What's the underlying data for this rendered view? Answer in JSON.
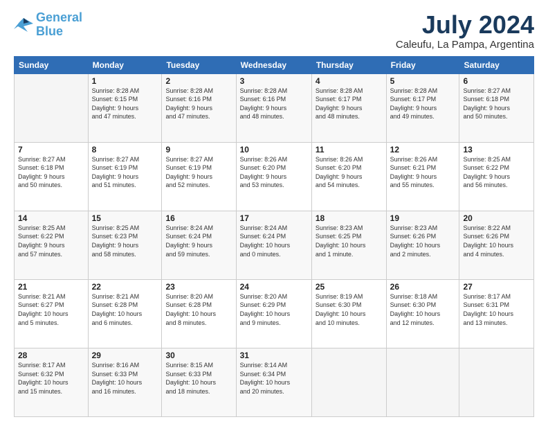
{
  "logo": {
    "line1": "General",
    "line2": "Blue"
  },
  "title": "July 2024",
  "subtitle": "Caleufu, La Pampa, Argentina",
  "weekdays": [
    "Sunday",
    "Monday",
    "Tuesday",
    "Wednesday",
    "Thursday",
    "Friday",
    "Saturday"
  ],
  "weeks": [
    [
      {
        "day": "",
        "info": ""
      },
      {
        "day": "1",
        "info": "Sunrise: 8:28 AM\nSunset: 6:15 PM\nDaylight: 9 hours\nand 47 minutes."
      },
      {
        "day": "2",
        "info": "Sunrise: 8:28 AM\nSunset: 6:16 PM\nDaylight: 9 hours\nand 47 minutes."
      },
      {
        "day": "3",
        "info": "Sunrise: 8:28 AM\nSunset: 6:16 PM\nDaylight: 9 hours\nand 48 minutes."
      },
      {
        "day": "4",
        "info": "Sunrise: 8:28 AM\nSunset: 6:17 PM\nDaylight: 9 hours\nand 48 minutes."
      },
      {
        "day": "5",
        "info": "Sunrise: 8:28 AM\nSunset: 6:17 PM\nDaylight: 9 hours\nand 49 minutes."
      },
      {
        "day": "6",
        "info": "Sunrise: 8:27 AM\nSunset: 6:18 PM\nDaylight: 9 hours\nand 50 minutes."
      }
    ],
    [
      {
        "day": "7",
        "info": "Sunrise: 8:27 AM\nSunset: 6:18 PM\nDaylight: 9 hours\nand 50 minutes."
      },
      {
        "day": "8",
        "info": "Sunrise: 8:27 AM\nSunset: 6:19 PM\nDaylight: 9 hours\nand 51 minutes."
      },
      {
        "day": "9",
        "info": "Sunrise: 8:27 AM\nSunset: 6:19 PM\nDaylight: 9 hours\nand 52 minutes."
      },
      {
        "day": "10",
        "info": "Sunrise: 8:26 AM\nSunset: 6:20 PM\nDaylight: 9 hours\nand 53 minutes."
      },
      {
        "day": "11",
        "info": "Sunrise: 8:26 AM\nSunset: 6:20 PM\nDaylight: 9 hours\nand 54 minutes."
      },
      {
        "day": "12",
        "info": "Sunrise: 8:26 AM\nSunset: 6:21 PM\nDaylight: 9 hours\nand 55 minutes."
      },
      {
        "day": "13",
        "info": "Sunrise: 8:25 AM\nSunset: 6:22 PM\nDaylight: 9 hours\nand 56 minutes."
      }
    ],
    [
      {
        "day": "14",
        "info": "Sunrise: 8:25 AM\nSunset: 6:22 PM\nDaylight: 9 hours\nand 57 minutes."
      },
      {
        "day": "15",
        "info": "Sunrise: 8:25 AM\nSunset: 6:23 PM\nDaylight: 9 hours\nand 58 minutes."
      },
      {
        "day": "16",
        "info": "Sunrise: 8:24 AM\nSunset: 6:24 PM\nDaylight: 9 hours\nand 59 minutes."
      },
      {
        "day": "17",
        "info": "Sunrise: 8:24 AM\nSunset: 6:24 PM\nDaylight: 10 hours\nand 0 minutes."
      },
      {
        "day": "18",
        "info": "Sunrise: 8:23 AM\nSunset: 6:25 PM\nDaylight: 10 hours\nand 1 minute."
      },
      {
        "day": "19",
        "info": "Sunrise: 8:23 AM\nSunset: 6:26 PM\nDaylight: 10 hours\nand 2 minutes."
      },
      {
        "day": "20",
        "info": "Sunrise: 8:22 AM\nSunset: 6:26 PM\nDaylight: 10 hours\nand 4 minutes."
      }
    ],
    [
      {
        "day": "21",
        "info": "Sunrise: 8:21 AM\nSunset: 6:27 PM\nDaylight: 10 hours\nand 5 minutes."
      },
      {
        "day": "22",
        "info": "Sunrise: 8:21 AM\nSunset: 6:28 PM\nDaylight: 10 hours\nand 6 minutes."
      },
      {
        "day": "23",
        "info": "Sunrise: 8:20 AM\nSunset: 6:28 PM\nDaylight: 10 hours\nand 8 minutes."
      },
      {
        "day": "24",
        "info": "Sunrise: 8:20 AM\nSunset: 6:29 PM\nDaylight: 10 hours\nand 9 minutes."
      },
      {
        "day": "25",
        "info": "Sunrise: 8:19 AM\nSunset: 6:30 PM\nDaylight: 10 hours\nand 10 minutes."
      },
      {
        "day": "26",
        "info": "Sunrise: 8:18 AM\nSunset: 6:30 PM\nDaylight: 10 hours\nand 12 minutes."
      },
      {
        "day": "27",
        "info": "Sunrise: 8:17 AM\nSunset: 6:31 PM\nDaylight: 10 hours\nand 13 minutes."
      }
    ],
    [
      {
        "day": "28",
        "info": "Sunrise: 8:17 AM\nSunset: 6:32 PM\nDaylight: 10 hours\nand 15 minutes."
      },
      {
        "day": "29",
        "info": "Sunrise: 8:16 AM\nSunset: 6:33 PM\nDaylight: 10 hours\nand 16 minutes."
      },
      {
        "day": "30",
        "info": "Sunrise: 8:15 AM\nSunset: 6:33 PM\nDaylight: 10 hours\nand 18 minutes."
      },
      {
        "day": "31",
        "info": "Sunrise: 8:14 AM\nSunset: 6:34 PM\nDaylight: 10 hours\nand 20 minutes."
      },
      {
        "day": "",
        "info": ""
      },
      {
        "day": "",
        "info": ""
      },
      {
        "day": "",
        "info": ""
      }
    ]
  ]
}
